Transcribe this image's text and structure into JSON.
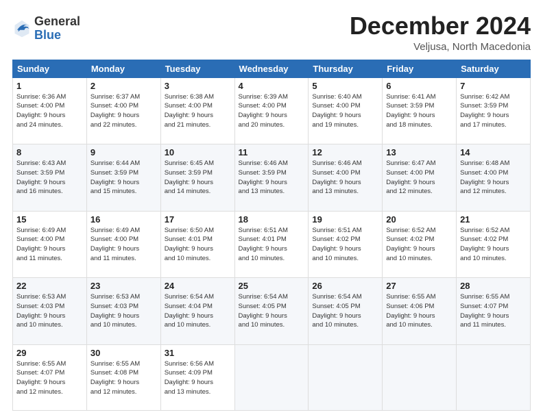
{
  "header": {
    "logo_general": "General",
    "logo_blue": "Blue",
    "month_title": "December 2024",
    "location": "Veljusa, North Macedonia"
  },
  "calendar": {
    "days_of_week": [
      "Sunday",
      "Monday",
      "Tuesday",
      "Wednesday",
      "Thursday",
      "Friday",
      "Saturday"
    ],
    "weeks": [
      [
        {
          "day": "",
          "info": ""
        },
        {
          "day": "2",
          "info": "Sunrise: 6:37 AM\nSunset: 4:00 PM\nDaylight: 9 hours\nand 22 minutes."
        },
        {
          "day": "3",
          "info": "Sunrise: 6:38 AM\nSunset: 4:00 PM\nDaylight: 9 hours\nand 21 minutes."
        },
        {
          "day": "4",
          "info": "Sunrise: 6:39 AM\nSunset: 4:00 PM\nDaylight: 9 hours\nand 20 minutes."
        },
        {
          "day": "5",
          "info": "Sunrise: 6:40 AM\nSunset: 4:00 PM\nDaylight: 9 hours\nand 19 minutes."
        },
        {
          "day": "6",
          "info": "Sunrise: 6:41 AM\nSunset: 3:59 PM\nDaylight: 9 hours\nand 18 minutes."
        },
        {
          "day": "7",
          "info": "Sunrise: 6:42 AM\nSunset: 3:59 PM\nDaylight: 9 hours\nand 17 minutes."
        }
      ],
      [
        {
          "day": "8",
          "info": "Sunrise: 6:43 AM\nSunset: 3:59 PM\nDaylight: 9 hours\nand 16 minutes."
        },
        {
          "day": "9",
          "info": "Sunrise: 6:44 AM\nSunset: 3:59 PM\nDaylight: 9 hours\nand 15 minutes."
        },
        {
          "day": "10",
          "info": "Sunrise: 6:45 AM\nSunset: 3:59 PM\nDaylight: 9 hours\nand 14 minutes."
        },
        {
          "day": "11",
          "info": "Sunrise: 6:46 AM\nSunset: 3:59 PM\nDaylight: 9 hours\nand 13 minutes."
        },
        {
          "day": "12",
          "info": "Sunrise: 6:46 AM\nSunset: 4:00 PM\nDaylight: 9 hours\nand 13 minutes."
        },
        {
          "day": "13",
          "info": "Sunrise: 6:47 AM\nSunset: 4:00 PM\nDaylight: 9 hours\nand 12 minutes."
        },
        {
          "day": "14",
          "info": "Sunrise: 6:48 AM\nSunset: 4:00 PM\nDaylight: 9 hours\nand 12 minutes."
        }
      ],
      [
        {
          "day": "15",
          "info": "Sunrise: 6:49 AM\nSunset: 4:00 PM\nDaylight: 9 hours\nand 11 minutes."
        },
        {
          "day": "16",
          "info": "Sunrise: 6:49 AM\nSunset: 4:00 PM\nDaylight: 9 hours\nand 11 minutes."
        },
        {
          "day": "17",
          "info": "Sunrise: 6:50 AM\nSunset: 4:01 PM\nDaylight: 9 hours\nand 10 minutes."
        },
        {
          "day": "18",
          "info": "Sunrise: 6:51 AM\nSunset: 4:01 PM\nDaylight: 9 hours\nand 10 minutes."
        },
        {
          "day": "19",
          "info": "Sunrise: 6:51 AM\nSunset: 4:02 PM\nDaylight: 9 hours\nand 10 minutes."
        },
        {
          "day": "20",
          "info": "Sunrise: 6:52 AM\nSunset: 4:02 PM\nDaylight: 9 hours\nand 10 minutes."
        },
        {
          "day": "21",
          "info": "Sunrise: 6:52 AM\nSunset: 4:02 PM\nDaylight: 9 hours\nand 10 minutes."
        }
      ],
      [
        {
          "day": "22",
          "info": "Sunrise: 6:53 AM\nSunset: 4:03 PM\nDaylight: 9 hours\nand 10 minutes."
        },
        {
          "day": "23",
          "info": "Sunrise: 6:53 AM\nSunset: 4:03 PM\nDaylight: 9 hours\nand 10 minutes."
        },
        {
          "day": "24",
          "info": "Sunrise: 6:54 AM\nSunset: 4:04 PM\nDaylight: 9 hours\nand 10 minutes."
        },
        {
          "day": "25",
          "info": "Sunrise: 6:54 AM\nSunset: 4:05 PM\nDaylight: 9 hours\nand 10 minutes."
        },
        {
          "day": "26",
          "info": "Sunrise: 6:54 AM\nSunset: 4:05 PM\nDaylight: 9 hours\nand 10 minutes."
        },
        {
          "day": "27",
          "info": "Sunrise: 6:55 AM\nSunset: 4:06 PM\nDaylight: 9 hours\nand 10 minutes."
        },
        {
          "day": "28",
          "info": "Sunrise: 6:55 AM\nSunset: 4:07 PM\nDaylight: 9 hours\nand 11 minutes."
        }
      ],
      [
        {
          "day": "29",
          "info": "Sunrise: 6:55 AM\nSunset: 4:07 PM\nDaylight: 9 hours\nand 12 minutes."
        },
        {
          "day": "30",
          "info": "Sunrise: 6:55 AM\nSunset: 4:08 PM\nDaylight: 9 hours\nand 12 minutes."
        },
        {
          "day": "31",
          "info": "Sunrise: 6:56 AM\nSunset: 4:09 PM\nDaylight: 9 hours\nand 13 minutes."
        },
        {
          "day": "",
          "info": ""
        },
        {
          "day": "",
          "info": ""
        },
        {
          "day": "",
          "info": ""
        },
        {
          "day": "",
          "info": ""
        }
      ]
    ],
    "first_week_first": {
      "day": "1",
      "info": "Sunrise: 6:36 AM\nSunset: 4:00 PM\nDaylight: 9 hours\nand 24 minutes."
    }
  }
}
